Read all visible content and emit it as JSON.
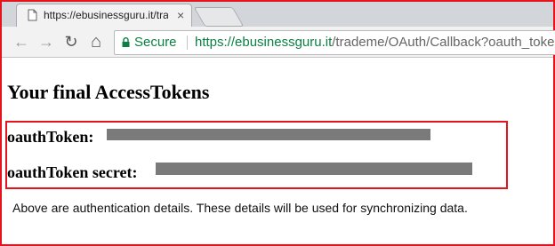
{
  "tab": {
    "title": "https://ebusinessguru.it/tra",
    "icon": "document-icon",
    "close": "×"
  },
  "toolbar": {
    "back": "←",
    "forward": "→",
    "reload": "↻",
    "home": "⌂",
    "secure_label": "Secure",
    "url_host": "https://ebusinessguru.it",
    "url_path": "/trademe/OAuth/Callback?oauth_toke"
  },
  "page": {
    "heading": "Your final AccessTokens",
    "token_label": "oauthToken:",
    "secret_label": "oauthToken secret:",
    "token_value_redacted": true,
    "secret_value_redacted": true,
    "footer": "Above are authentication details. These details will be used for synchronizing data."
  },
  "colors": {
    "highlight_border": "#e3141c",
    "secure_green": "#0b8043",
    "redaction": "#7a7a7a"
  }
}
